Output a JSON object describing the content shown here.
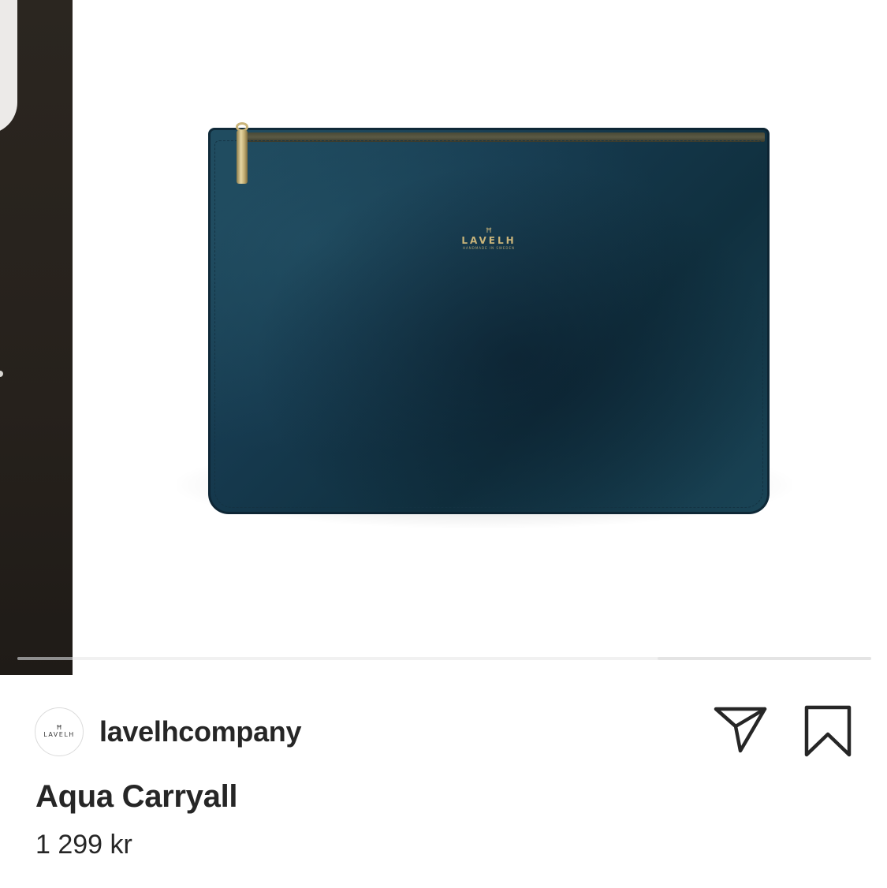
{
  "carousel": {
    "slide_progress": 0.25,
    "product_brand_wordmark": "LAVELH",
    "product_brand_monogram": "Ħ",
    "product_brand_tagline": "HANDMADE IN SWEDEN",
    "colors": {
      "pouch": "#163a4f",
      "hardware": "#c9b47a"
    }
  },
  "post": {
    "avatar": {
      "monogram": "Ħ",
      "wordmark": "LAVELH"
    },
    "username": "lavelhcompany",
    "share_icon": "paper-plane-icon",
    "save_icon": "bookmark-icon"
  },
  "product": {
    "title": "Aqua Carryall",
    "price": "1 299 kr"
  }
}
